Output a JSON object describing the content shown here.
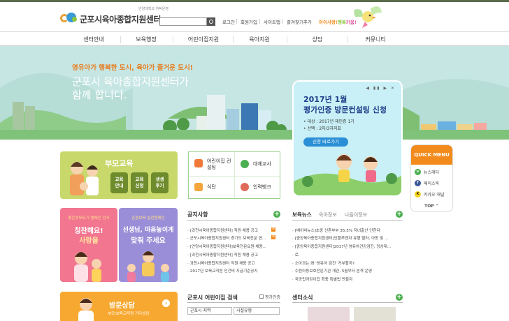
{
  "header": {
    "logo_sub": "안양대학교 위탁운영",
    "logo_title": "군포시육아종합지원센터",
    "search_placeholder": "",
    "util_links": [
      "로그인",
      "회원가입",
      "사이트맵",
      "즐겨찾기추가"
    ],
    "slogan": {
      "a": "아이사랑",
      "sep": "!",
      "b": "행복",
      "c": "키움",
      "end": "!"
    }
  },
  "gnb": [
    "센터안내",
    "보육행정",
    "어린이집지원",
    "육아지원",
    "상담",
    "커뮤니티"
  ],
  "hero": {
    "line1": "영유아가 행복한 도시, 육아가 즐거운 도시!",
    "line2": "군포시 육아종합지원센터가",
    "line3": "함께 합니다."
  },
  "popup": {
    "controls": "◀ ▮▮ ▶ ✕",
    "title1": "2017년 1월",
    "title2": "평가인증 방문컨설팅 신청",
    "info1": "• 대상 : 2017년 재인증 1기",
    "info2": "• 선택 : 2차/3차지표",
    "button": "신청 바로가기"
  },
  "edu": {
    "title": "부모교육",
    "buttons": [
      [
        "교육",
        "안내"
      ],
      [
        "교육",
        "신청"
      ],
      [
        "생생",
        "후기"
      ]
    ]
  },
  "quick_links": [
    "어린이집 컨설팅",
    "대체교사",
    "식단",
    "인력뱅크"
  ],
  "campaign1": {
    "head": "좋은부모되기 캠페인 전사",
    "l1": "칭찬해요!",
    "l2": "사랑을"
  },
  "campaign2": {
    "head": "존중보육 실천캠페인",
    "l1": "선생님, 마음놓이게",
    "l2": "맞춰 주세요"
  },
  "consult": {
    "title": "방문상담",
    "sub": "부모/보육교직원 기타상담",
    "arrow": "›"
  },
  "notice": {
    "title": "공지사항",
    "items": [
      "[과천시육아종합지원센터] 직원 채용 공고",
      "군포시육아종합지원센터 경기도 보육전문 연...",
      "[안양시육아종합지원센터]보육전문요원 채용...",
      "[과천시육아종합지원센터] 직원 채용 공고",
      "과천시육아종합지원센터 직원 채용 공고",
      "2017년 보육교직원 인건비 지급기준공지"
    ]
  },
  "news": {
    "tabs": [
      "보육뉴스",
      "육아정보",
      "나들이정보"
    ],
    "items": [
      "[베이비뉴스]초중 신혼부부 35.5% 자녀출산 안한다",
      "[중앙육아종합지원센터]인플루엔자 유행 빨라, 아동 및 ...",
      "[중앙육아종합지원센터]2017년 영유아건강검진, 정상대...",
      "로.",
      "소아과는 왜 '영유아 검진' 거부할까?",
      "수원아동보호전문기관 개관, 5월부터 본격 운영",
      "국공립어린이집 확충 특별법 만들자"
    ]
  },
  "daycare_search": {
    "title": "군포시 어린이집 검색",
    "checkbox": "평가인증",
    "select_region": "군포시 지역",
    "select_type": "시설유형"
  },
  "center_news": {
    "title": "센터소식"
  },
  "quick_menu": {
    "title": "QUICK MENU",
    "items": [
      "뉴스레터",
      "페이스북",
      "카카오 채널"
    ],
    "top": "TOP ⌃"
  },
  "colors": {
    "accent_orange": "#f28b1c",
    "accent_green": "#4caf50",
    "hero_sky": "#c6e6e3"
  }
}
